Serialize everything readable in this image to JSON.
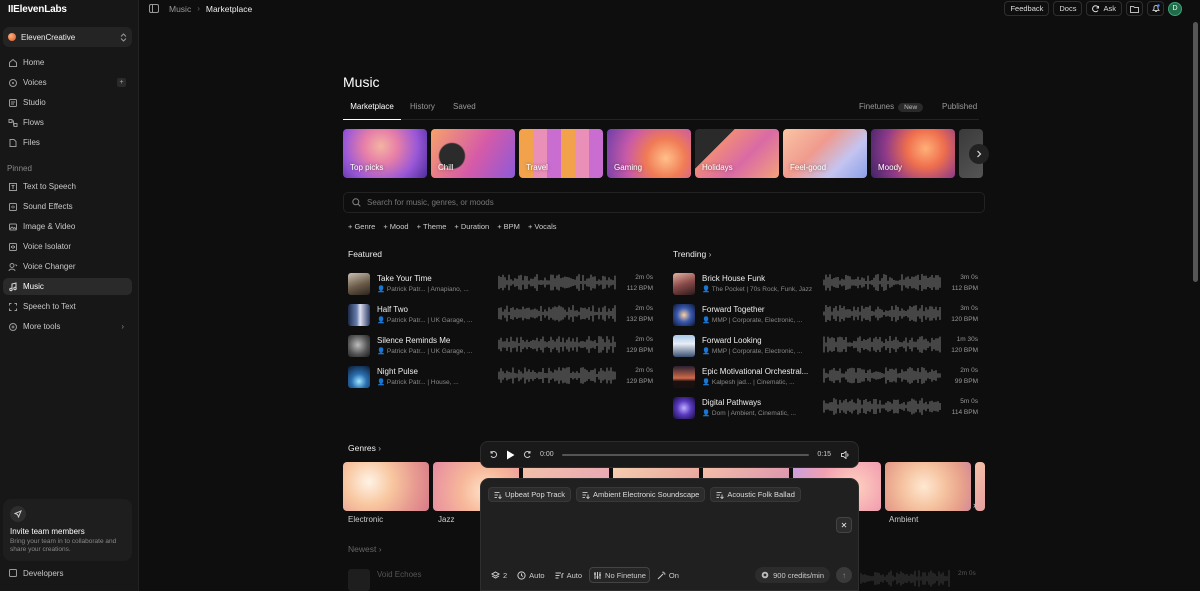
{
  "app": {
    "logo": "IIElevenLabs"
  },
  "sidebar": {
    "workspace": "ElevenCreative",
    "main_items": [
      {
        "label": "Home",
        "icon": "home-icon"
      },
      {
        "label": "Voices",
        "icon": "voices-icon"
      },
      {
        "label": "Studio",
        "icon": "studio-icon"
      },
      {
        "label": "Flows",
        "icon": "flows-icon"
      },
      {
        "label": "Files",
        "icon": "files-icon"
      }
    ],
    "pinned_label": "Pinned",
    "pinned_items": [
      {
        "label": "Text to Speech",
        "icon": "text-to-speech-icon"
      },
      {
        "label": "Sound Effects",
        "icon": "sound-effects-icon"
      },
      {
        "label": "Image & Video",
        "icon": "image-video-icon"
      },
      {
        "label": "Voice Isolator",
        "icon": "voice-isolator-icon"
      },
      {
        "label": "Voice Changer",
        "icon": "voice-changer-icon"
      },
      {
        "label": "Music",
        "icon": "music-icon"
      },
      {
        "label": "Speech to Text",
        "icon": "speech-to-text-icon"
      },
      {
        "label": "More tools",
        "icon": "more-tools-icon"
      }
    ],
    "active": "Music",
    "invite": {
      "title": "Invite team members",
      "subtitle": "Bring your team in to collaborate and share your creations."
    },
    "developers": "Developers"
  },
  "topbar": {
    "crumbs": [
      "Music",
      "Marketplace"
    ],
    "feedback": "Feedback",
    "docs": "Docs",
    "ask": "Ask",
    "avatar": "D"
  },
  "page": {
    "title": "Music",
    "tabs": [
      "Marketplace",
      "History",
      "Saved"
    ],
    "active_tab": "Marketplace",
    "right_tabs": {
      "finetunes": "Finetunes",
      "new_badge": "New",
      "published": "Published"
    },
    "categories": [
      "Top picks",
      "Chill",
      "Travel",
      "Gaming",
      "Holidays",
      "Feel-good",
      "Moody"
    ],
    "search_placeholder": "Search for music, genres, or moods",
    "filters": [
      "Genre",
      "Mood",
      "Theme",
      "Duration",
      "BPM",
      "Vocals"
    ],
    "featured_title": "Featured",
    "trending_title": "Trending",
    "featured": [
      {
        "title": "Take Your Time",
        "artist": "Patrick Patr...",
        "tags": "Amapiano, ...",
        "duration": "2m 0s",
        "bpm": "112 BPM"
      },
      {
        "title": "Half Two",
        "artist": "Patrick Patr...",
        "tags": "UK Garage, ...",
        "duration": "2m 0s",
        "bpm": "132 BPM"
      },
      {
        "title": "Silence Reminds Me",
        "artist": "Patrick Patr...",
        "tags": "UK Garage, ...",
        "duration": "2m 0s",
        "bpm": "129 BPM"
      },
      {
        "title": "Night Pulse",
        "artist": "Patrick Patr...",
        "tags": "House, ...",
        "duration": "2m 0s",
        "bpm": "129 BPM"
      }
    ],
    "trending": [
      {
        "title": "Brick House Funk",
        "artist": "The Pocket",
        "tags": "70s Rock, Funk, Jazz",
        "duration": "3m 0s",
        "bpm": "112 BPM"
      },
      {
        "title": "Forward Together",
        "artist": "MMP",
        "tags": "Corporate, Electronic, ...",
        "duration": "3m 0s",
        "bpm": "120 BPM"
      },
      {
        "title": "Forward Looking",
        "artist": "MMP",
        "tags": "Corporate, Electronic, ...",
        "duration": "1m 30s",
        "bpm": "120 BPM"
      },
      {
        "title": "Epic Motivational Orchestral...",
        "artist": "Kalpesh jad...",
        "tags": "Cinematic, ...",
        "duration": "2m 0s",
        "bpm": "99 BPM"
      },
      {
        "title": "Digital Pathways",
        "artist": "Dom",
        "tags": "Ambient, Cinematic, ...",
        "duration": "5m 0s",
        "bpm": "114 BPM"
      }
    ],
    "genres_title": "Genres",
    "genres": [
      "Electronic",
      "Jazz",
      "",
      "",
      "",
      "",
      "Ambient"
    ],
    "newest_title": "Newest",
    "newest_first": "Void Echoes",
    "newest_duration": "2m 0s"
  },
  "player": {
    "current": "0:00",
    "total": "0:15",
    "progress": 0
  },
  "composer": {
    "suggestions": [
      "Upbeat Pop Track",
      "Ambient Electronic Soundscape",
      "Acoustic Folk Ballad"
    ],
    "options": {
      "variants": "2",
      "duration": "Auto",
      "lyrics": "Auto",
      "finetune": "No Finetune",
      "magic": "On"
    },
    "credits": "900 credits/min"
  },
  "colors": {
    "background": "#0e0e0e",
    "sidebar": "#171717",
    "accent_avatar": "#1f6b4a"
  }
}
